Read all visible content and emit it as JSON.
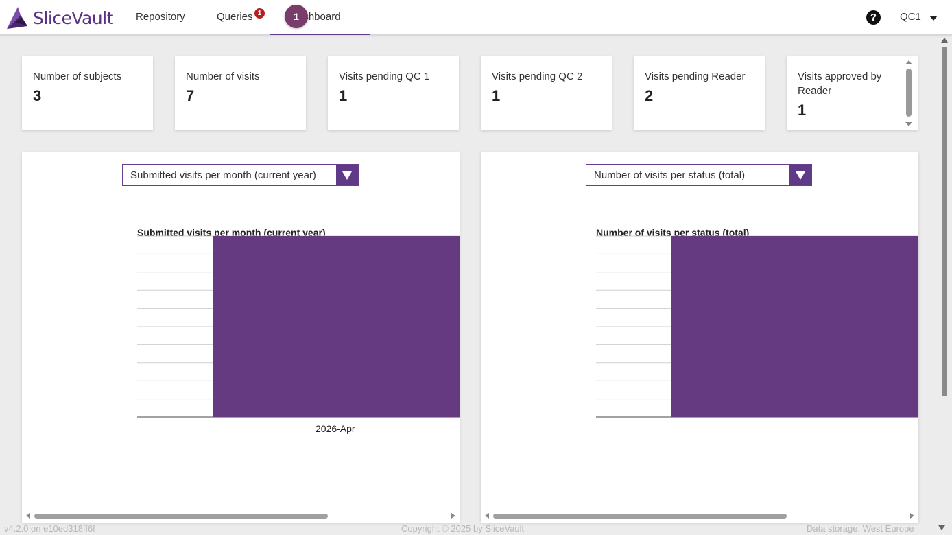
{
  "app": {
    "name": "SliceVault",
    "brand_color": "#5a3283"
  },
  "nav": {
    "items": [
      {
        "label": "Repository"
      },
      {
        "label": "Queries",
        "badge": "1"
      },
      {
        "label": "ashboard"
      }
    ],
    "step_badge": "1",
    "help_icon": "question-circle-icon",
    "user": "QC1"
  },
  "stats": [
    {
      "title": "Number of subjects",
      "value": "3"
    },
    {
      "title": "Number of visits",
      "value": "7"
    },
    {
      "title": "Visits pending QC 1",
      "value": "1"
    },
    {
      "title": "Visits pending QC 2",
      "value": "1"
    },
    {
      "title": "Visits pending Reader",
      "value": "2"
    },
    {
      "title": "Visits approved by Reader",
      "value": "1"
    }
  ],
  "panels": [
    {
      "select_label": "Submitted visits per month (current year)"
    },
    {
      "select_label": "Number of visits per status (total)"
    }
  ],
  "chart_data": [
    {
      "type": "bar",
      "title": "Submitted visits per month (current year)",
      "categories": [
        "2026-Apr"
      ],
      "series": [
        {
          "values": [
            7
          ]
        }
      ],
      "bar_color": "#653a80",
      "grid": true
    },
    {
      "type": "bar",
      "title": "Number of visits per status (total)",
      "categories": [],
      "series": [
        {
          "values": [
            7
          ]
        }
      ],
      "bar_color": "#653a80",
      "grid": true
    }
  ],
  "footer": {
    "version": "v4.2.0 on e10ed318ff6f",
    "copyright": "Copyright © 2025 by SliceVault",
    "storage": "Data storage: West Europe"
  }
}
